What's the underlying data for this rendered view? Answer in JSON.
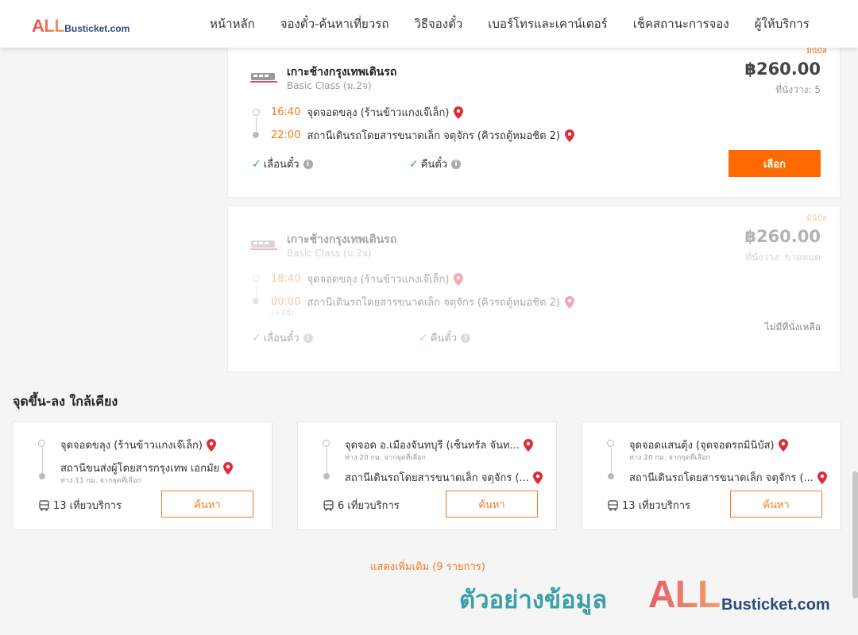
{
  "logo": {
    "all": "ALL",
    "rest": "Busticket.com"
  },
  "nav": [
    "หน้าหลัก",
    "จองตั๋ว-ค้นหาเที่ยวรถ",
    "วิธีจองตั๋ว",
    "เบอร์โทรและเคาน์เตอร์",
    "เช็คสถานะการจอง",
    "ผู้ให้บริการ"
  ],
  "results": [
    {
      "tag": "มินิบัส",
      "route": "เกาะช้างกรุงเทพเดินรถ",
      "class": "Basic Class (ม.2จ)",
      "price": "฿260.00",
      "seats": "ที่นั่งว่าง: 5",
      "depart_time": "16:40",
      "depart_stop": "จุดจอดขลุง (ร้านข้าวแกงเจ๊เล็ก)",
      "arrive_time": "22:00",
      "arrive_stop": "สถานีเดินรถโดยสารขนาดเล็ก จตุจักร (คิวรถตู้หมอชิต 2)",
      "feature_1": "เลื่อนตั๋ว",
      "feature_2": "คืนตั๋ว",
      "button": "เลือก"
    },
    {
      "tag": "มินิบัส",
      "route": "เกาะช้างกรุงเทพเดินรถ",
      "class": "Basic Class (ม.2จ)",
      "price": "฿260.00",
      "seats": "ที่นั่งว่าง: ขายหมด",
      "depart_time": "18:40",
      "depart_stop": "จุดจอดขลุง (ร้านข้าวแกงเจ๊เล็ก)",
      "arrive_time": "00:00",
      "arrive_stop": "สถานีเดินรถโดยสารขนาดเล็ก จตุจักร (คิวรถตู้หมอชิต 2)",
      "next_day": "(+1d)",
      "feature_1": "เลื่อนตั๋ว",
      "feature_2": "คืนตั๋ว",
      "soldout": "ไม่มีที่นั่งเหลือ"
    }
  ],
  "nearby": {
    "title": "จุดขึ้น-ลง ใกล้เคียง",
    "items": [
      {
        "from": "จุดจอดขลุง (ร้านข้าวแกงเจ๊เล็ก)",
        "from_sub": "",
        "to": "สถานีขนส่งผู้โดยสารกรุงเทพ เอกมัย",
        "to_sub": "ห่าง 11 กม. จากจุดที่เลือก",
        "trips": "13 เที่ยวบริการ",
        "button": "ค้นหา"
      },
      {
        "from": "จุดจอด อ.เมืองจันทบุรี (เซ็นทรัล จันท...",
        "from_sub": "ห่าง 20 กม. จากจุดที่เลือก",
        "to": "สถานีเดินรถโดยสารขนาดเล็ก จตุจักร (...",
        "to_sub": "",
        "trips": "6 เที่ยวบริการ",
        "button": "ค้นหา"
      },
      {
        "from": "จุดจอดแสนตุ้ง (จุดจอดรถมินิบัส)",
        "from_sub": "ห่าง 20 กม. จากจุดที่เลือก",
        "to": "สถานีเดินรถโดยสารขนาดเล็ก จตุจักร (...",
        "to_sub": "",
        "trips": "13 เที่ยวบริการ",
        "button": "ค้นหา"
      }
    ],
    "show_more": "แสดงเพิ่มเติม (9 รายการ)"
  },
  "watermark": {
    "text": "ตัวอย่างข้อมูล",
    "all": "ALL",
    "rest": "Busticket.com"
  },
  "colors": {
    "accent": "#ff6a00",
    "link": "#f47b20",
    "check": "#2bb24c",
    "pin": "#e02b3a"
  }
}
